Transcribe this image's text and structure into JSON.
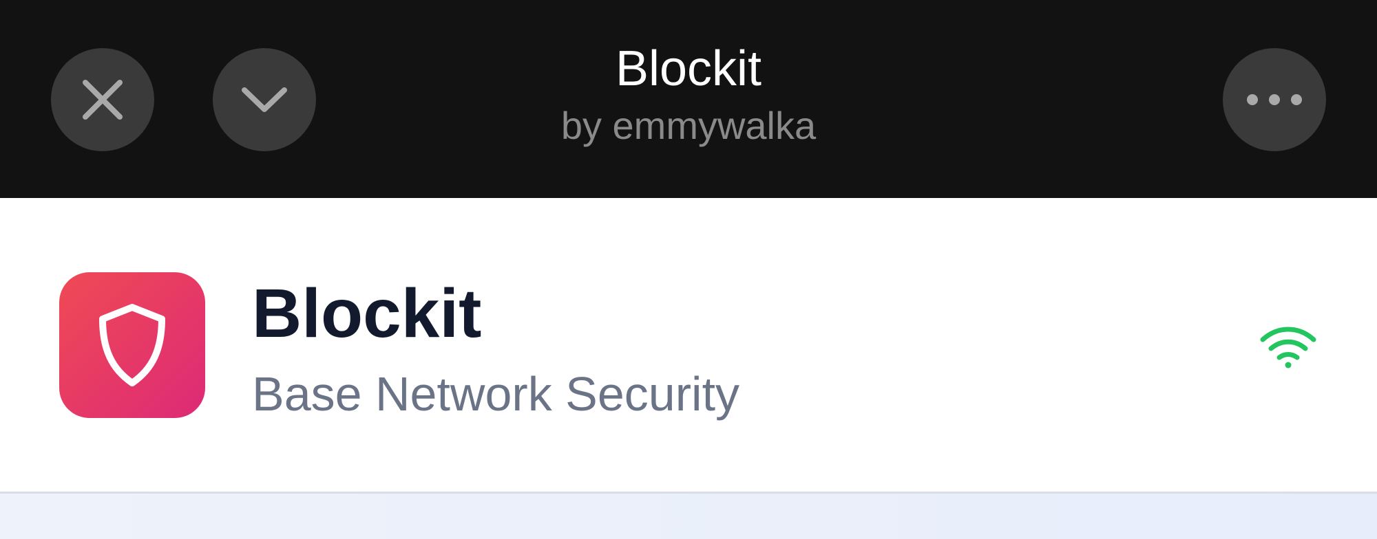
{
  "header": {
    "title": "Blockit",
    "subtitle": "by emmywalka",
    "close_icon": "close-icon",
    "collapse_icon": "chevron-down-icon",
    "more_icon": "more-horizontal-icon"
  },
  "app": {
    "name": "Blockit",
    "description": "Base Network Security",
    "icon": "shield-icon",
    "status_icon": "wifi-icon",
    "colors": {
      "icon_gradient_start": "#f04a54",
      "icon_gradient_end": "#dd2a77",
      "status_green": "#22c55e"
    }
  }
}
